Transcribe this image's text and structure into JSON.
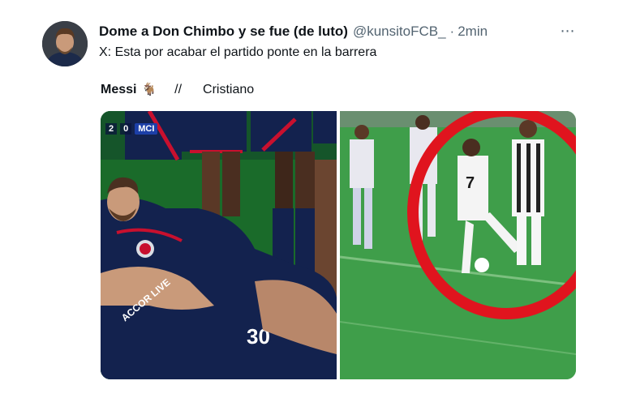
{
  "tweet": {
    "author": {
      "display_name": "Dome a Don Chimbo y se fue (de luto)",
      "handle": "@kunsitoFCB_",
      "separator": "·",
      "time": "2min"
    },
    "text": "X: Esta por acabar el partido ponte en la barrera",
    "more_icon": "⋯",
    "caption": {
      "left": "Messi",
      "emoji": "🐐",
      "separator": "//",
      "right": "Cristiano"
    }
  },
  "media": {
    "left_image": {
      "scoreboard": {
        "home": "2",
        "away": "0",
        "team": "MCI"
      },
      "jersey_number": "30",
      "sponsor": "ACCOR LIVE"
    },
    "right_image": {
      "jersey_number": "7"
    }
  },
  "colors": {
    "text": "#0f1419",
    "secondary": "#536471",
    "pitch_left": "#1a6b2a",
    "pitch_right": "#3f9e4a",
    "psg_navy": "#13224e",
    "circle_red": "#e0141e"
  }
}
